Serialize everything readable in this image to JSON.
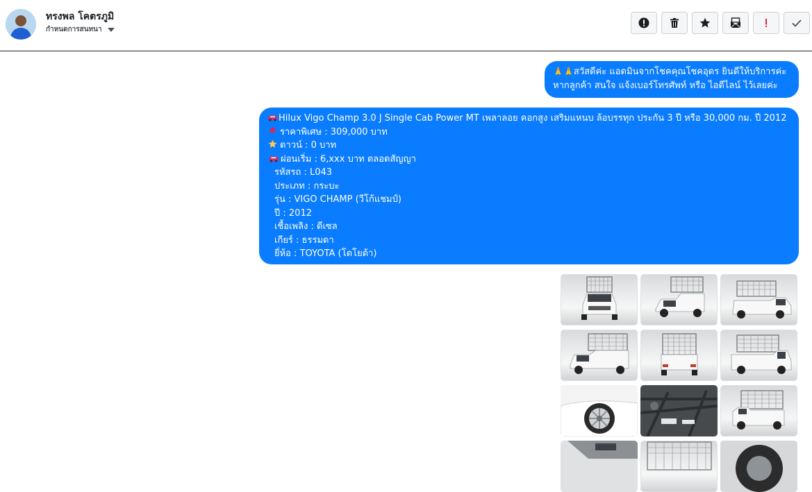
{
  "header": {
    "contact_name": "ทรงพล โคตรภูมิ",
    "assign_label": "กำหนดการสนทนา",
    "actions": [
      {
        "name": "report-button",
        "icon": "alert-circle-icon",
        "label": "!"
      },
      {
        "name": "delete-button",
        "icon": "trash-icon"
      },
      {
        "name": "star-button",
        "icon": "star-icon"
      },
      {
        "name": "mark-unread-button",
        "icon": "mail-icon"
      },
      {
        "name": "important-button",
        "icon": "exclamation-icon",
        "label": "!",
        "color": "#e41e3f"
      },
      {
        "name": "done-button",
        "icon": "check-icon"
      }
    ]
  },
  "messages": {
    "greeting": {
      "emoji": "🙏🙏",
      "line1": "สวัสดีค่ะ แอดมินจากโชคคุณโชคอุดร ยินดีให้บริการค่ะ",
      "line2": "หากลูกค้า สนใจ แจ้งเบอร์โทรศัพท์ หรือ ไอดีไลน์  ไว้เลยค่ะ"
    },
    "listing": {
      "title": "Hilux Vigo Champ 3.0 J Single Cab Power MT เพลาลอย คอกสูง เสริมแหนบ ล้อบรรทุก ประกัน 3 ปี หรือ 30,000 กม. ปี 2012",
      "price": "ราคาพิเศษ : 309,000 บาท",
      "down": "ดาวน์ : 0 บาท",
      "installment": "ผ่อนเริ่ม : 6,xxx บาท ตลอดสัญญา",
      "code": "รหัสรถ : L043",
      "type": "ประเภท : กระบะ",
      "model": "รุ่น : VIGO CHAMP (วีโก้แชมป์)",
      "year": "ปี : 2012",
      "fuel": "เชื้อเพลิง : ดีเซล",
      "gear": "เกียร์ : ธรรมดา",
      "brand": "ยี่ห้อ : TOYOTA (โตโยต้า)"
    }
  },
  "photos": [
    "truck-front-view",
    "truck-front-angle",
    "truck-front-quarter",
    "truck-front-left",
    "truck-rear-view",
    "truck-side-view",
    "wheel-closeup",
    "undercarriage",
    "truck-rear-quarter",
    "interior-door",
    "cargo-rack",
    "spare-tire"
  ],
  "colors": {
    "bubble": "#0a7cff",
    "important": "#e41e3f"
  }
}
